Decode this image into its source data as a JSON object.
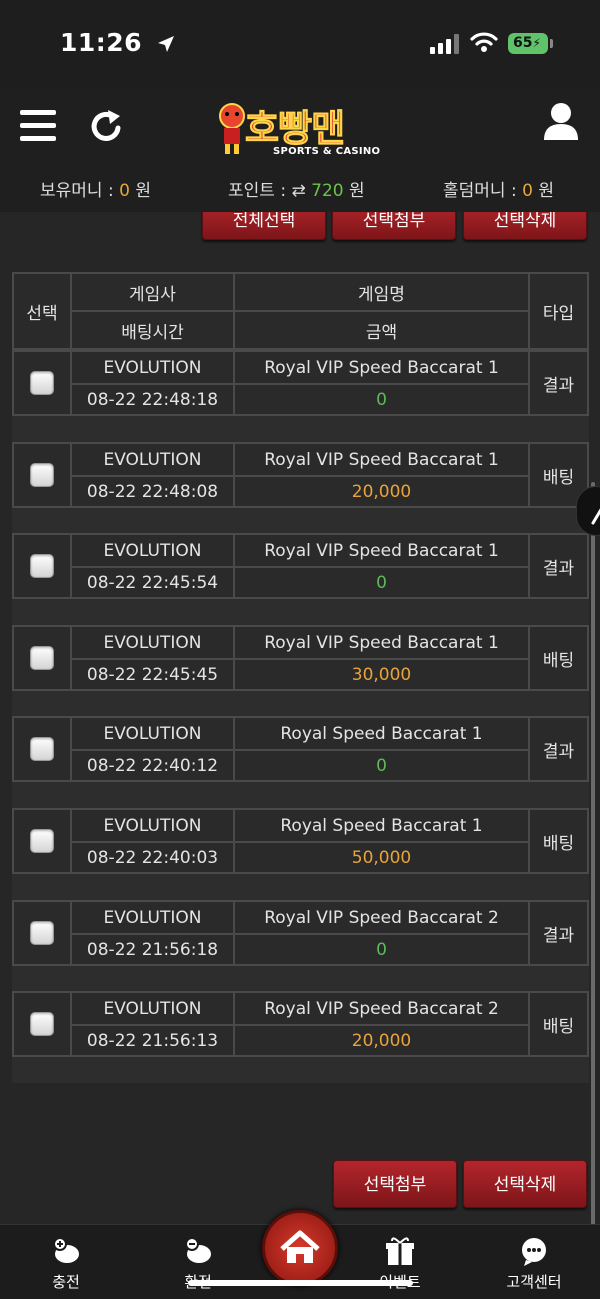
{
  "status_bar": {
    "time": "11:26",
    "battery": "65"
  },
  "header": {
    "logo_text": "호빵맨",
    "logo_sub": "SPORTS & CASINO",
    "balances": {
      "holding_label": "보유머니 : ",
      "holding_value": "0",
      "point_label": "포인트 : ",
      "point_value": "720",
      "holdem_label": "홀덤머니 : ",
      "holdem_value": "0",
      "unit": "원"
    }
  },
  "actions_top": {
    "select_all": "전체선택",
    "attach": "선택첨부",
    "delete": "선택삭제"
  },
  "table": {
    "headers": {
      "select": "선택",
      "provider": "게임사",
      "game": "게임명",
      "type": "타입",
      "time": "배팅시간",
      "amount": "금액"
    },
    "rows": [
      {
        "provider": "EVOLUTION",
        "game": "Royal VIP Speed Baccarat 1",
        "time": "08-22 22:48:18",
        "amount": "0",
        "type": "결과"
      },
      {
        "provider": "EVOLUTION",
        "game": "Royal VIP Speed Baccarat 1",
        "time": "08-22 22:48:08",
        "amount": "20,000",
        "type": "배팅"
      },
      {
        "provider": "EVOLUTION",
        "game": "Royal VIP Speed Baccarat 1",
        "time": "08-22 22:45:54",
        "amount": "0",
        "type": "결과"
      },
      {
        "provider": "EVOLUTION",
        "game": "Royal VIP Speed Baccarat 1",
        "time": "08-22 22:45:45",
        "amount": "30,000",
        "type": "배팅"
      },
      {
        "provider": "EVOLUTION",
        "game": "Royal Speed Baccarat 1",
        "time": "08-22 22:40:12",
        "amount": "0",
        "type": "결과"
      },
      {
        "provider": "EVOLUTION",
        "game": "Royal Speed Baccarat 1",
        "time": "08-22 22:40:03",
        "amount": "50,000",
        "type": "배팅"
      },
      {
        "provider": "EVOLUTION",
        "game": "Royal VIP Speed Baccarat 2",
        "time": "08-22 21:56:18",
        "amount": "0",
        "type": "결과"
      },
      {
        "provider": "EVOLUTION",
        "game": "Royal VIP Speed Baccarat 2",
        "time": "08-22 21:56:13",
        "amount": "20,000",
        "type": "배팅"
      }
    ]
  },
  "actions_bottom": {
    "attach": "선택첨부",
    "delete": "선택삭제"
  },
  "tabbar": {
    "charge": "충전",
    "exchange": "환전",
    "event": "이벤트",
    "support": "고객센터"
  },
  "colors": {
    "accent_red": "#9c1d22",
    "amount_positive": "#e8a33a",
    "amount_zero": "#5fb85a"
  }
}
